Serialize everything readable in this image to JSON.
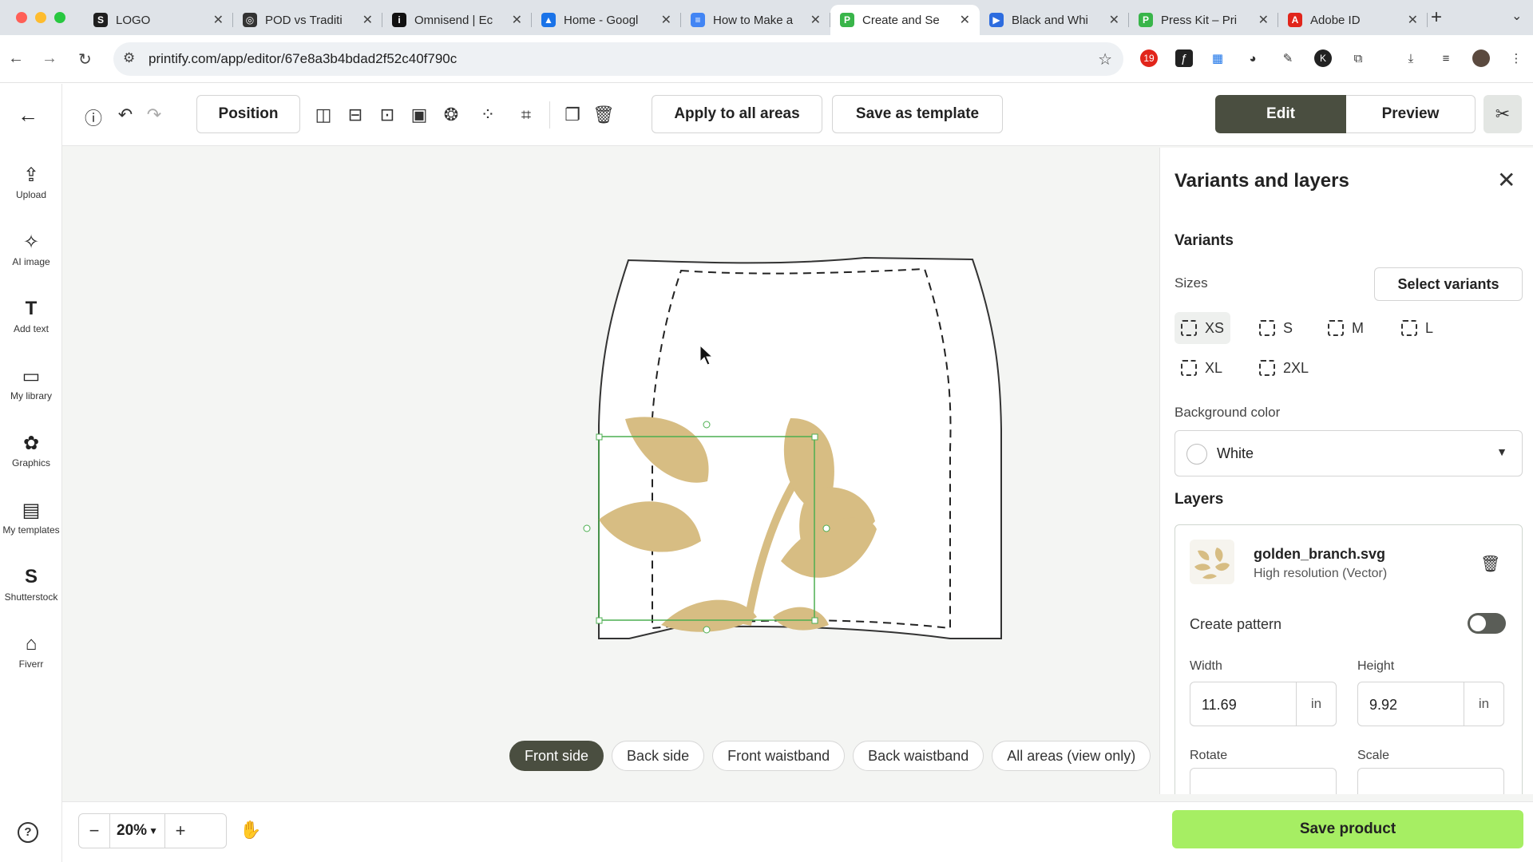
{
  "browser": {
    "tabs": [
      {
        "title": "LOGO",
        "fav": "S",
        "color": "#1f1f1f"
      },
      {
        "title": "POD vs Traditi",
        "fav": "◎",
        "color": "#333333"
      },
      {
        "title": "Omnisend | Ec",
        "fav": "i",
        "color": "#111111"
      },
      {
        "title": "Home - Googl",
        "fav": "▲",
        "color": "#1a73e8"
      },
      {
        "title": "How to Make a",
        "fav": "≡",
        "color": "#4285f4"
      },
      {
        "title": "Create and Se",
        "fav": "P",
        "color": "#39b54a"
      },
      {
        "title": "Black and Whi",
        "fav": "▶",
        "color": "#2d6cdf"
      },
      {
        "title": "Press Kit – Pri",
        "fav": "P",
        "color": "#39b54a"
      },
      {
        "title": "Adobe ID",
        "fav": "A",
        "color": "#e1251b"
      }
    ],
    "url": "printify.com/app/editor/67e8a3b4bdad2f52c40f790c",
    "ext_badge": "19"
  },
  "leftbar": {
    "tools": [
      {
        "label": "Upload",
        "icon": "upload-icon"
      },
      {
        "label": "AI image",
        "icon": "magic-wand-icon"
      },
      {
        "label": "Add text",
        "icon": "text-icon"
      },
      {
        "label": "My library",
        "icon": "folder-icon"
      },
      {
        "label": "Graphics",
        "icon": "graphics-icon"
      },
      {
        "label": "My templates",
        "icon": "templates-icon"
      },
      {
        "label": "Shutterstock",
        "icon": "shutterstock-icon"
      },
      {
        "label": "Fiverr",
        "icon": "fiverr-icon"
      }
    ]
  },
  "toolbar": {
    "position_label": "Position",
    "apply_label": "Apply to all areas",
    "save_template_label": "Save as template",
    "edit_label": "Edit",
    "preview_label": "Preview"
  },
  "canvas": {
    "side_tabs": [
      "Front side",
      "Back side",
      "Front waistband",
      "Back waistband",
      "All areas (view only)"
    ],
    "active_side": 0,
    "artwork_color": "#d7bd83"
  },
  "bottom": {
    "zoom": "20%",
    "save_label": "Save product",
    "save_color": "#a6ee63"
  },
  "panel": {
    "title": "Variants and layers",
    "variants_title": "Variants",
    "sizes_label": "Sizes",
    "select_variants_label": "Select variants",
    "sizes": [
      "XS",
      "S",
      "M",
      "L",
      "XL",
      "2XL"
    ],
    "selected_size": "XS",
    "bg_label": "Background color",
    "bg_value": "White",
    "layers_title": "Layers",
    "layer": {
      "name": "golden_branch.svg",
      "subtitle": "High resolution (Vector)",
      "pattern_label": "Create pattern",
      "pattern_on": false,
      "width_label": "Width",
      "width_value": "11.69",
      "height_label": "Height",
      "height_value": "9.92",
      "unit": "in",
      "rotate_label": "Rotate",
      "scale_label": "Scale"
    }
  },
  "colors": {
    "accent_dark": "#4a4e40",
    "selection_green": "#4caf50"
  }
}
